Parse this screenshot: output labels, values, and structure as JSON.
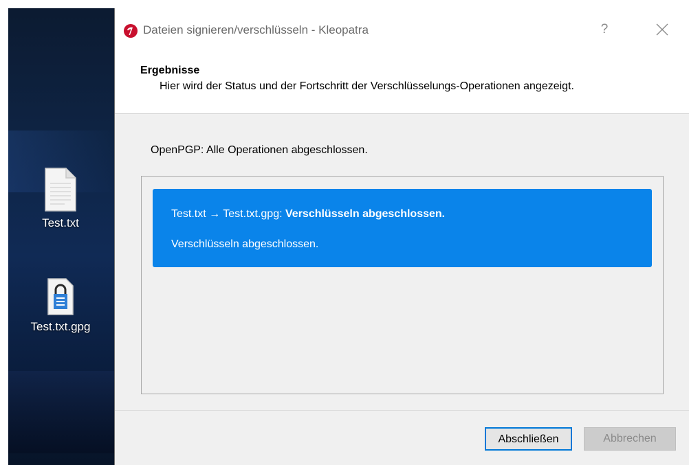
{
  "desktop": {
    "icons": [
      {
        "label": "Test.txt",
        "icon": "text-file-icon"
      },
      {
        "label": "Test.txt.gpg",
        "icon": "encrypted-file-icon"
      }
    ]
  },
  "dialog": {
    "title": "Dateien signieren/verschlüsseln - Kleopatra",
    "help_label": "?",
    "header": {
      "title": "Ergebnisse",
      "subtitle": "Hier wird der Status und der Fortschritt der Verschlüsselungs-Operationen angezeigt."
    },
    "status": "OpenPGP: Alle Operationen abgeschlossen.",
    "results": [
      {
        "files": "Test.txt → Test.txt.gpg:",
        "result_bold": "Verschlüsseln abgeschlossen.",
        "detail": "Verschlüsseln abgeschlossen."
      }
    ],
    "buttons": {
      "finish": "Abschließen",
      "cancel": "Abbrechen"
    }
  },
  "colors": {
    "selection": "#0a84ea",
    "focus_border": "#0078d7",
    "app_icon": "#c8102e"
  }
}
